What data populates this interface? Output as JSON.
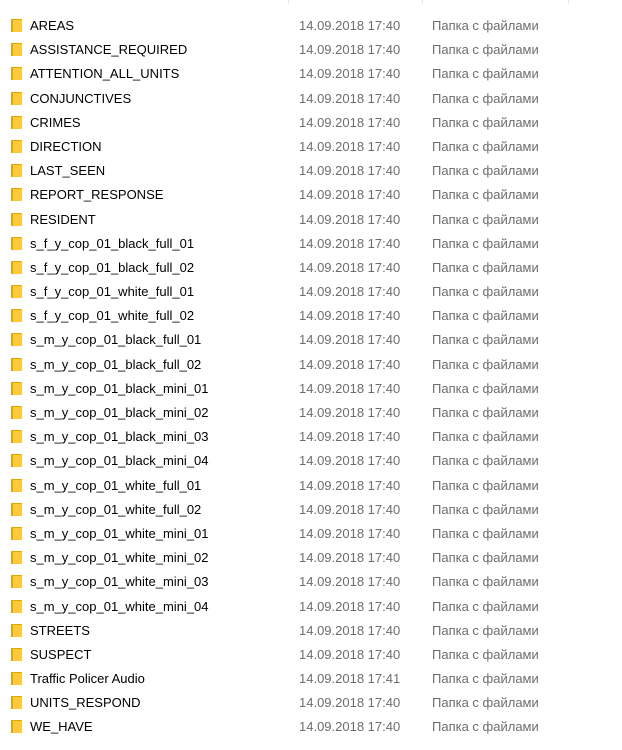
{
  "colors": {
    "folder_back": "#e0a800",
    "folder_front": "#ffc83d",
    "secondary_text": "#6d6d6d",
    "hover_bg": "#e5f3ff"
  },
  "files": [
    {
      "name": "AREAS",
      "date": "14.09.2018 17:40",
      "type": "Папка с файлами",
      "icon": "folder-icon"
    },
    {
      "name": "ASSISTANCE_REQUIRED",
      "date": "14.09.2018 17:40",
      "type": "Папка с файлами",
      "icon": "folder-icon"
    },
    {
      "name": "ATTENTION_ALL_UNITS",
      "date": "14.09.2018 17:40",
      "type": "Папка с файлами",
      "icon": "folder-icon"
    },
    {
      "name": "CONJUNCTIVES",
      "date": "14.09.2018 17:40",
      "type": "Папка с файлами",
      "icon": "folder-icon"
    },
    {
      "name": "CRIMES",
      "date": "14.09.2018 17:40",
      "type": "Папка с файлами",
      "icon": "folder-icon"
    },
    {
      "name": "DIRECTION",
      "date": "14.09.2018 17:40",
      "type": "Папка с файлами",
      "icon": "folder-icon"
    },
    {
      "name": "LAST_SEEN",
      "date": "14.09.2018 17:40",
      "type": "Папка с файлами",
      "icon": "folder-icon"
    },
    {
      "name": "REPORT_RESPONSE",
      "date": "14.09.2018 17:40",
      "type": "Папка с файлами",
      "icon": "folder-icon"
    },
    {
      "name": "RESIDENT",
      "date": "14.09.2018 17:40",
      "type": "Папка с файлами",
      "icon": "folder-icon"
    },
    {
      "name": "s_f_y_cop_01_black_full_01",
      "date": "14.09.2018 17:40",
      "type": "Папка с файлами",
      "icon": "folder-icon"
    },
    {
      "name": "s_f_y_cop_01_black_full_02",
      "date": "14.09.2018 17:40",
      "type": "Папка с файлами",
      "icon": "folder-icon"
    },
    {
      "name": "s_f_y_cop_01_white_full_01",
      "date": "14.09.2018 17:40",
      "type": "Папка с файлами",
      "icon": "folder-icon"
    },
    {
      "name": "s_f_y_cop_01_white_full_02",
      "date": "14.09.2018 17:40",
      "type": "Папка с файлами",
      "icon": "folder-icon"
    },
    {
      "name": "s_m_y_cop_01_black_full_01",
      "date": "14.09.2018 17:40",
      "type": "Папка с файлами",
      "icon": "folder-icon"
    },
    {
      "name": "s_m_y_cop_01_black_full_02",
      "date": "14.09.2018 17:40",
      "type": "Папка с файлами",
      "icon": "folder-icon"
    },
    {
      "name": "s_m_y_cop_01_black_mini_01",
      "date": "14.09.2018 17:40",
      "type": "Папка с файлами",
      "icon": "folder-icon"
    },
    {
      "name": "s_m_y_cop_01_black_mini_02",
      "date": "14.09.2018 17:40",
      "type": "Папка с файлами",
      "icon": "folder-icon"
    },
    {
      "name": "s_m_y_cop_01_black_mini_03",
      "date": "14.09.2018 17:40",
      "type": "Папка с файлами",
      "icon": "folder-icon"
    },
    {
      "name": "s_m_y_cop_01_black_mini_04",
      "date": "14.09.2018 17:40",
      "type": "Папка с файлами",
      "icon": "folder-icon"
    },
    {
      "name": "s_m_y_cop_01_white_full_01",
      "date": "14.09.2018 17:40",
      "type": "Папка с файлами",
      "icon": "folder-icon"
    },
    {
      "name": "s_m_y_cop_01_white_full_02",
      "date": "14.09.2018 17:40",
      "type": "Папка с файлами",
      "icon": "folder-icon"
    },
    {
      "name": "s_m_y_cop_01_white_mini_01",
      "date": "14.09.2018 17:40",
      "type": "Папка с файлами",
      "icon": "folder-icon"
    },
    {
      "name": "s_m_y_cop_01_white_mini_02",
      "date": "14.09.2018 17:40",
      "type": "Папка с файлами",
      "icon": "folder-icon"
    },
    {
      "name": "s_m_y_cop_01_white_mini_03",
      "date": "14.09.2018 17:40",
      "type": "Папка с файлами",
      "icon": "folder-icon"
    },
    {
      "name": "s_m_y_cop_01_white_mini_04",
      "date": "14.09.2018 17:40",
      "type": "Папка с файлами",
      "icon": "folder-icon"
    },
    {
      "name": "STREETS",
      "date": "14.09.2018 17:40",
      "type": "Папка с файлами",
      "icon": "folder-icon"
    },
    {
      "name": "SUSPECT",
      "date": "14.09.2018 17:40",
      "type": "Папка с файлами",
      "icon": "folder-icon"
    },
    {
      "name": "Traffic Policer Audio",
      "date": "14.09.2018 17:41",
      "type": "Папка с файлами",
      "icon": "folder-icon"
    },
    {
      "name": "UNITS_RESPOND",
      "date": "14.09.2018 17:40",
      "type": "Папка с файлами",
      "icon": "folder-icon"
    },
    {
      "name": "WE_HAVE",
      "date": "14.09.2018 17:40",
      "type": "Папка с файлами",
      "icon": "folder-icon"
    }
  ]
}
